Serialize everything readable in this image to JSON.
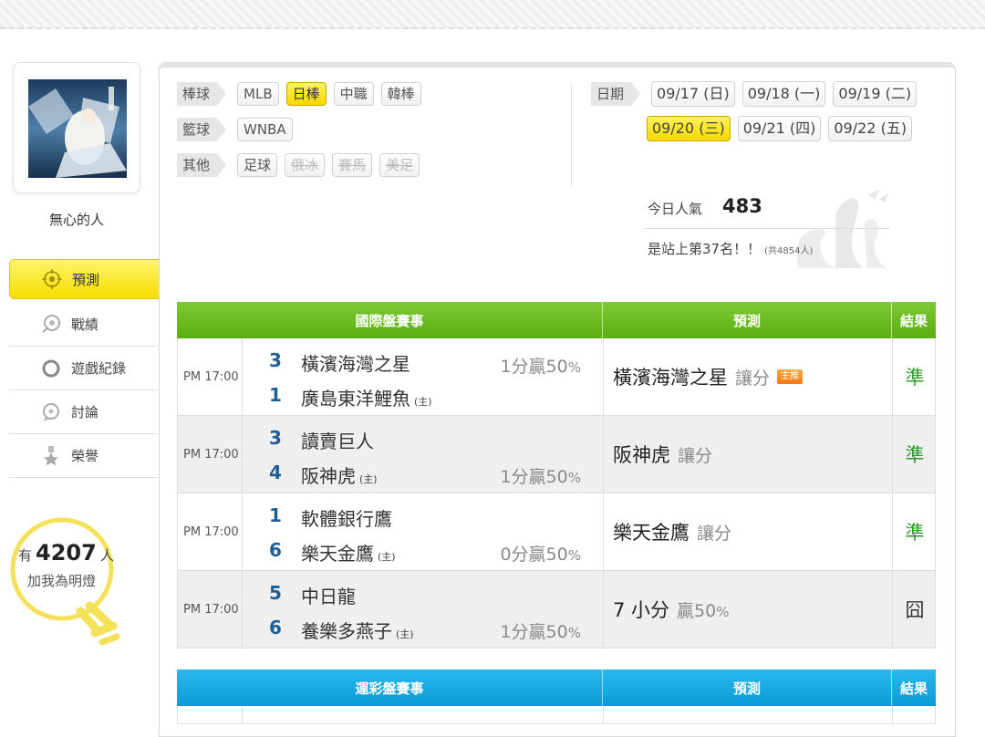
{
  "user": {
    "name": "無心的人"
  },
  "nav": [
    {
      "label": "預測",
      "icon": "target-icon",
      "active": true
    },
    {
      "label": "戰績",
      "icon": "trophy-coin-icon",
      "active": false
    },
    {
      "label": "遊戲紀錄",
      "icon": "ring-icon",
      "active": false
    },
    {
      "label": "討論",
      "icon": "chat-icon",
      "active": false
    },
    {
      "label": "榮譽",
      "icon": "medal-icon",
      "active": false
    }
  ],
  "fans": {
    "prefix": "有",
    "count": "4207",
    "suffix": "人",
    "cta": "加我為明燈"
  },
  "categories": {
    "baseball": {
      "label": "棒球",
      "items": [
        "MLB",
        "日棒",
        "中職",
        "韓棒"
      ]
    },
    "basketball": {
      "label": "籃球",
      "items": [
        "WNBA"
      ]
    },
    "other": {
      "label": "其他",
      "items": [
        "足球",
        "俄冰",
        "賽馬",
        "美足"
      ]
    }
  },
  "dates": {
    "label": "日期",
    "row1": [
      "09/17 (日)",
      "09/18 (一)",
      "09/19 (二)"
    ],
    "row2": [
      "09/20 (三)",
      "09/21 (四)",
      "09/22 (五)"
    ]
  },
  "stats": {
    "pop_label": "今日人氣",
    "pop_value": "483",
    "rank_text": "是站上第37名！！",
    "rank_total": "(共4854人)"
  },
  "intl_table": {
    "head_match": "國際盤賽事",
    "head_pred": "預測",
    "head_result": "結果",
    "rows": [
      {
        "time": "PM 17:00",
        "away_score": "3",
        "away_team": "橫濱海灣之星",
        "home_score": "1",
        "home_team": "廣島東洋鯉魚",
        "host_mark": "(主)",
        "odds": "1分贏50",
        "odds_pct": "%",
        "odds_pos": "top",
        "pred_team": "橫濱海灣之星",
        "pred_type": "讓分",
        "pred_pct": "",
        "badge": "主推",
        "result": "準"
      },
      {
        "time": "PM 17:00",
        "away_score": "3",
        "away_team": "讀賣巨人",
        "home_score": "4",
        "home_team": "阪神虎",
        "host_mark": "(主)",
        "odds": "1分贏50",
        "odds_pct": "%",
        "odds_pos": "bottom",
        "pred_team": "阪神虎",
        "pred_type": "讓分",
        "pred_pct": "",
        "badge": "",
        "result": "準"
      },
      {
        "time": "PM 17:00",
        "away_score": "1",
        "away_team": "軟體銀行鷹",
        "home_score": "6",
        "home_team": "樂天金鷹",
        "host_mark": "(主)",
        "odds": "0分贏50",
        "odds_pct": "%",
        "odds_pos": "bottom",
        "pred_team": "樂天金鷹",
        "pred_type": "讓分",
        "pred_pct": "",
        "badge": "",
        "result": "準"
      },
      {
        "time": "PM 17:00",
        "away_score": "5",
        "away_team": "中日龍",
        "home_score": "6",
        "home_team": "養樂多燕子",
        "host_mark": "(主)",
        "odds": "1分贏50",
        "odds_pct": "%",
        "odds_pos": "bottom",
        "pred_team": "7 小分",
        "pred_type": "贏50",
        "pred_pct": "%",
        "badge": "",
        "result": "囧"
      }
    ]
  },
  "lottery_table": {
    "head_match": "運彩盤賽事",
    "head_pred": "預測",
    "head_result": "結果"
  },
  "colors": {
    "accent_yellow": "#f5d800",
    "green_header": "#5aae10",
    "blue_header": "#0a9bd6",
    "result_ok": "#2e9a2e"
  }
}
